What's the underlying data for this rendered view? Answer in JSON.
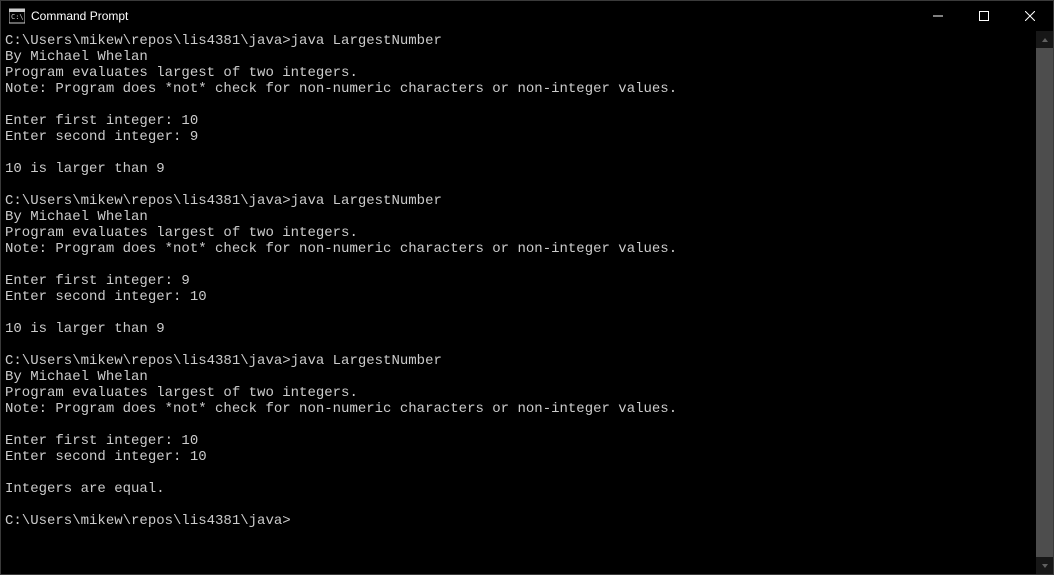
{
  "window": {
    "title": "Command Prompt"
  },
  "terminal": {
    "lines": [
      "C:\\Users\\mikew\\repos\\lis4381\\java>java LargestNumber",
      "By Michael Whelan",
      "Program evaluates largest of two integers.",
      "Note: Program does *not* check for non-numeric characters or non-integer values.",
      "",
      "Enter first integer: 10",
      "Enter second integer: 9",
      "",
      "10 is larger than 9",
      "",
      "C:\\Users\\mikew\\repos\\lis4381\\java>java LargestNumber",
      "By Michael Whelan",
      "Program evaluates largest of two integers.",
      "Note: Program does *not* check for non-numeric characters or non-integer values.",
      "",
      "Enter first integer: 9",
      "Enter second integer: 10",
      "",
      "10 is larger than 9",
      "",
      "C:\\Users\\mikew\\repos\\lis4381\\java>java LargestNumber",
      "By Michael Whelan",
      "Program evaluates largest of two integers.",
      "Note: Program does *not* check for non-numeric characters or non-integer values.",
      "",
      "Enter first integer: 10",
      "Enter second integer: 10",
      "",
      "Integers are equal.",
      "",
      "C:\\Users\\mikew\\repos\\lis4381\\java>"
    ]
  }
}
